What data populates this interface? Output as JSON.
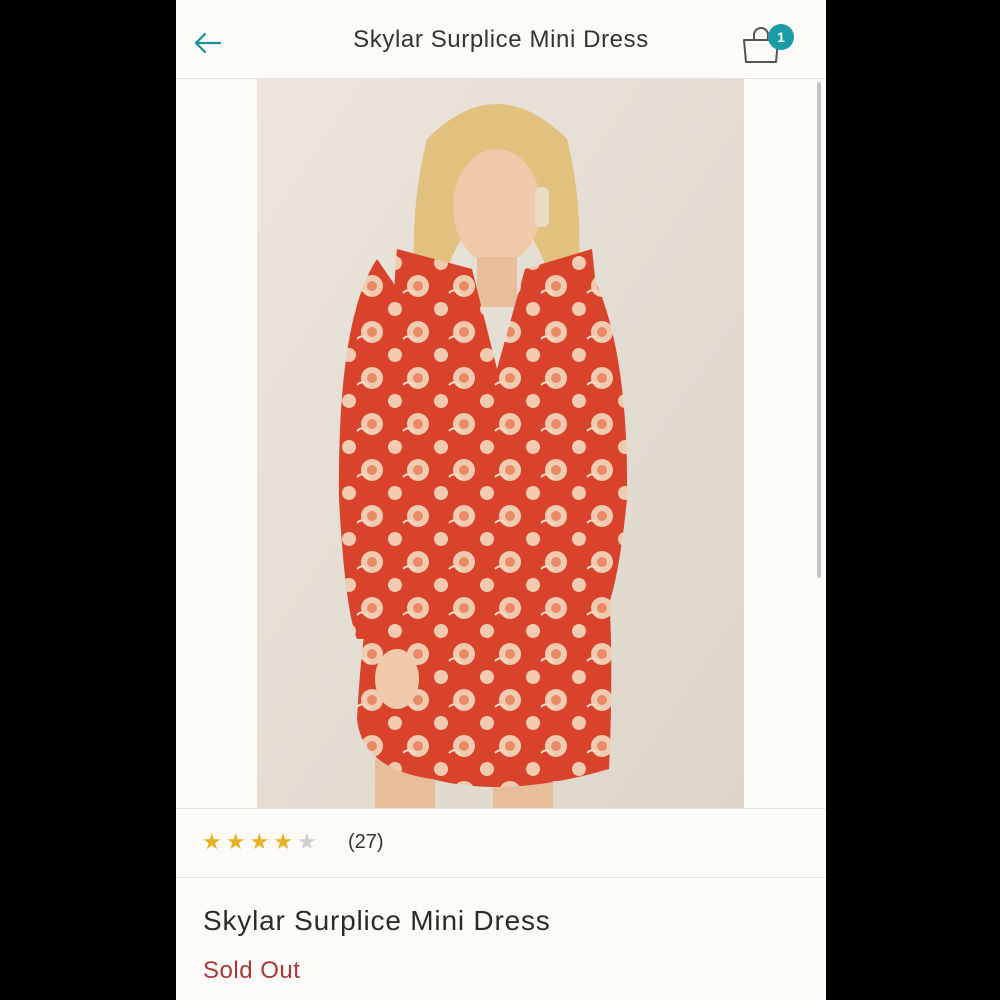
{
  "header": {
    "title": "Skylar Surplice Mini Dress",
    "cart_count": "1"
  },
  "icons": {
    "back": "back-arrow-icon",
    "cart": "shopping-bag-icon"
  },
  "product": {
    "image_alt": "Model wearing red floral print long-sleeve surplice mini dress",
    "rating": 4,
    "rating_max": 5,
    "review_count": "(27)",
    "name": "Skylar Surplice Mini Dress",
    "status": "Sold Out"
  },
  "colors": {
    "accent": "#1a9ba6",
    "star": "#e8b11f",
    "star_empty": "#cfcfcf",
    "sold_out": "#a8363a"
  }
}
